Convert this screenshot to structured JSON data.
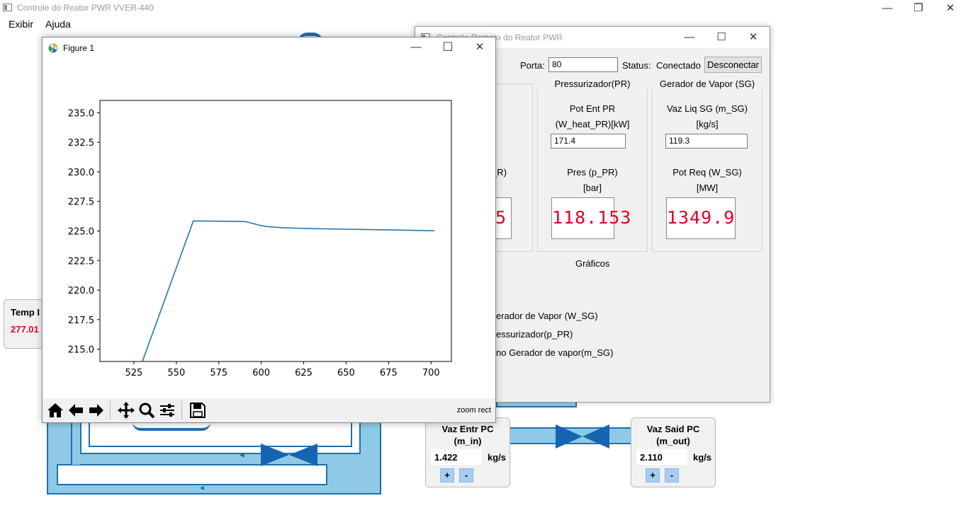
{
  "main_window": {
    "title": "Controle do Reator PWR VVER-440",
    "menu": [
      "Exibir",
      "Ajuda"
    ],
    "controls": {
      "minimize": "—",
      "restore": "❐",
      "close": "✕"
    }
  },
  "diagram": {
    "temp_panel": {
      "label": "Temp I",
      "value": "277.01"
    },
    "vaz_entr": {
      "title_line1": "Vaz Entr PC",
      "title_line2": "(m_in)",
      "value": "1.422",
      "unit": "kg/s",
      "plus": "+",
      "minus": "-"
    },
    "vaz_said": {
      "title_line1": "Vaz Said PC",
      "title_line2": "(m_out)",
      "value": "2.110",
      "unit": "kg/s",
      "plus": "+",
      "minus": "-"
    },
    "colors": {
      "pipe": "#8ecae6",
      "pipe_border": "#1f6fb2",
      "valve": "#1565b0"
    }
  },
  "remote_window": {
    "title": "Controle Remoto do Reator PWR",
    "controls": {
      "minimize": "—",
      "maximize": "☐",
      "close": "✕"
    },
    "port_label": "Porta:",
    "port_value": "80",
    "status_label": "Status:",
    "status_value": "Conectado",
    "disconnect_button": "Desconectar",
    "left_partial": {
      "label": "_R)",
      "display": "5"
    },
    "pressurizer": {
      "group_title": "Pressurizador(PR)",
      "power_label_line1": "Pot Ent PR",
      "power_label_line2": "(W_heat_PR)[kW]",
      "power_value": "171.4",
      "pressure_label": "Pres (p_PR)",
      "pressure_unit": "[bar]",
      "pressure_display": "118.153"
    },
    "steam_gen": {
      "group_title": "Gerador de Vapor (SG)",
      "flow_label_line1": "Vaz Liq SG (m_SG)",
      "flow_label_line2": "[kg/s]",
      "flow_value": "119.3",
      "power_label": "Pot Req (W_SG)",
      "power_unit": "[MW]",
      "power_display": "1349.9"
    },
    "graphs_title": "Gráficos",
    "graph_options": [
      "erador de Vapor (W_SG)",
      "essurizador(p_PR)",
      "no Gerador de vapor(m_SG)"
    ]
  },
  "figure_window": {
    "title": "Figure 1",
    "controls": {
      "minimize": "—",
      "maximize": "☐",
      "close": "✕"
    },
    "toolbar_status": "zoom rect",
    "toolbar_icons": [
      "home-icon",
      "back-icon",
      "forward-icon",
      "pan-icon",
      "zoom-icon",
      "configure-icon",
      "save-icon"
    ]
  },
  "chart_data": {
    "type": "line",
    "title": "",
    "xlabel": "",
    "ylabel": "",
    "xlim": [
      505,
      712
    ],
    "ylim": [
      213.96,
      236.04
    ],
    "xticks": [
      525,
      550,
      575,
      600,
      625,
      650,
      675,
      700
    ],
    "yticks": [
      215.0,
      217.5,
      220.0,
      222.5,
      225.0,
      227.5,
      230.0,
      232.5,
      235.0
    ],
    "ytick_labels": [
      "215.0",
      "217.5",
      "220.0",
      "222.5",
      "225.0",
      "227.5",
      "230.0",
      "232.5",
      "235.0"
    ],
    "series": [
      {
        "color": "#1f77b4",
        "x": [
          505,
          530,
          560,
          590,
          592,
          596,
          600,
          605,
          612,
          620,
          630,
          650,
          680,
          702
        ],
        "y": [
          206.5,
          213.96,
          225.85,
          225.8,
          225.75,
          225.6,
          225.45,
          225.35,
          225.28,
          225.24,
          225.2,
          225.15,
          225.08,
          225.02
        ]
      }
    ],
    "grid": false,
    "legend": "none"
  }
}
